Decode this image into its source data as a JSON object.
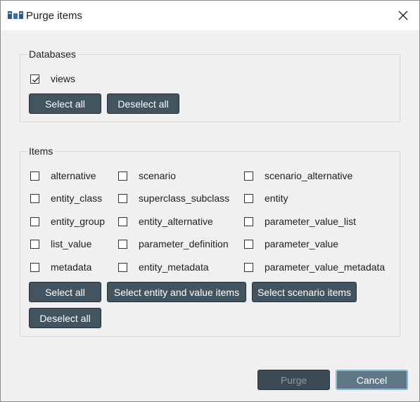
{
  "window": {
    "title": "Purge items",
    "icon": "database-icon",
    "close_icon": "close-icon"
  },
  "databases": {
    "legend": "Databases",
    "items": [
      {
        "label": "views",
        "checked": true
      }
    ],
    "select_all": "Select all",
    "deselect_all": "Deselect all"
  },
  "items": {
    "legend": "Items",
    "checkboxes": [
      {
        "label": "alternative",
        "checked": false
      },
      {
        "label": "scenario",
        "checked": false
      },
      {
        "label": "scenario_alternative",
        "checked": false
      },
      {
        "label": "entity_class",
        "checked": false
      },
      {
        "label": "superclass_subclass",
        "checked": false
      },
      {
        "label": "entity",
        "checked": false
      },
      {
        "label": "entity_group",
        "checked": false
      },
      {
        "label": "entity_alternative",
        "checked": false
      },
      {
        "label": "parameter_value_list",
        "checked": false
      },
      {
        "label": "list_value",
        "checked": false
      },
      {
        "label": "parameter_definition",
        "checked": false
      },
      {
        "label": "parameter_value",
        "checked": false
      },
      {
        "label": "metadata",
        "checked": false
      },
      {
        "label": "entity_metadata",
        "checked": false
      },
      {
        "label": "parameter_value_metadata",
        "checked": false
      }
    ],
    "select_all": "Select all",
    "select_entity_value": "Select entity and value items",
    "select_scenario": "Select scenario items",
    "deselect_all": "Deselect all"
  },
  "footer": {
    "purge": "Purge",
    "purge_enabled": false,
    "cancel": "Cancel"
  },
  "colors": {
    "button_bg": "#435461",
    "button_text": "#ffffff",
    "dialog_bg": "#f0f0f0",
    "focus_ring": "#93c3de"
  }
}
